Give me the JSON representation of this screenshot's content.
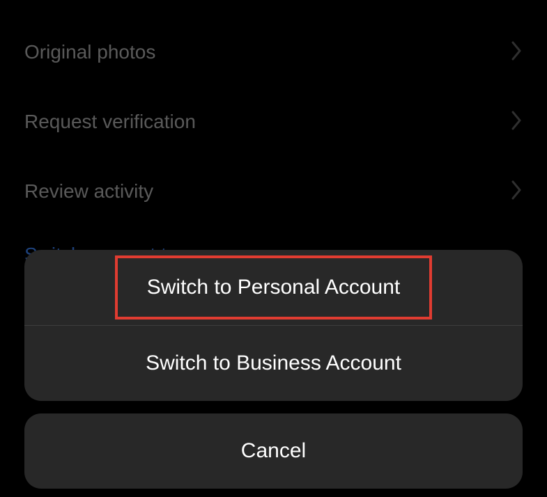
{
  "settings": {
    "items": [
      {
        "label": "Original photos"
      },
      {
        "label": "Request verification"
      },
      {
        "label": "Review activity"
      }
    ],
    "switch_type_label": "Switch account type"
  },
  "action_sheet": {
    "personal_label": "Switch to Personal Account",
    "business_label": "Switch to Business Account",
    "cancel_label": "Cancel"
  }
}
